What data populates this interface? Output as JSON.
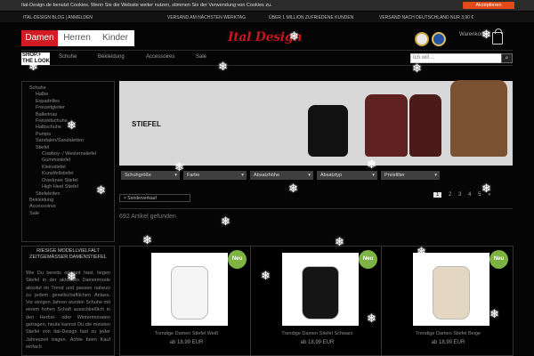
{
  "cookie": {
    "text": "Ital-Design.de benutzt Cookies. Wenn Sie die Website weiter nutzen, stimmen Sie der Verwendung von Cookies zu.",
    "button": "Akzeptieren"
  },
  "topbar": {
    "left": "ITAL-DESIGN BLOG | ANMELDEN",
    "center1": "VERSAND AM NÄCHSTEN WERKTAG",
    "center2": "ÜBER 1 MILLION ZUFRIEDENE KUNDEN",
    "right": "VERSAND NACH DEUTSCHLAND NUR 3,90 €"
  },
  "header": {
    "genders": [
      "Damen",
      "Herren",
      "Kinder"
    ],
    "logo": "Ital Design",
    "cart_label": "Warenkorb"
  },
  "nav": {
    "shop_logo": "SHOP.+\nTHE LOOK",
    "items": [
      "Schuhe",
      "Bekleidung",
      "Accessoires",
      "Sale"
    ],
    "search_placeholder": "Ich will ..."
  },
  "sidebar": {
    "items": [
      {
        "label": "Schuhe",
        "level": 0
      },
      {
        "label": "Halbe",
        "level": 1
      },
      {
        "label": "Espadrilles",
        "level": 1
      },
      {
        "label": "Freizeitgleiter",
        "level": 1
      },
      {
        "label": "Ballerinas",
        "level": 1
      },
      {
        "label": "Freizeitschuhe",
        "level": 1
      },
      {
        "label": "Halbschuhe",
        "level": 1
      },
      {
        "label": "Pumps",
        "level": 1
      },
      {
        "label": "Sandalen/Sandaletten",
        "level": 1
      },
      {
        "label": "Stiefel",
        "level": 1
      },
      {
        "label": "Cowboy- / Westernstiefel",
        "level": 2
      },
      {
        "label": "Gummistiefel",
        "level": 2
      },
      {
        "label": "Kleinstiefel",
        "level": 2
      },
      {
        "label": "Kunstfellstiefel",
        "level": 2
      },
      {
        "label": "Overknee Stiefel",
        "level": 2
      },
      {
        "label": "High Heel Stiefel",
        "level": 2
      },
      {
        "label": "Stiefeletten",
        "level": 1
      },
      {
        "label": "Bekleidung",
        "level": 0
      },
      {
        "label": "Accessoires",
        "level": 0
      },
      {
        "label": "Sale",
        "level": 0
      }
    ]
  },
  "hero": {
    "title": "STIEFEL"
  },
  "filters": [
    "Schuhgröße",
    "Farbe",
    "Absatzhöhe",
    "Absatztyp",
    "Preisfilter"
  ],
  "tag": "× Sonderverkauf",
  "pagination": [
    "1",
    "2",
    "3",
    "4",
    "5",
    "»"
  ],
  "count": "692 Artikel gefunden",
  "promo": {
    "title": "RIESIGE MODELLVIELFALT\nZEITGEMÄSSER DAMENSTIEFEL",
    "text": "Wie Du bereits erkannt hast, liegen Stiefel in der aktuellen Damenmode absolut im Trend und passen nahezu zu jedem gesellschaftlichen Anlass. Vor einigen Jahren wurden Schuhe mit einem hohen Schaft ausschließlich in den Herbst- oder Wintermonaten getragen, heute kannst Du die meisten Stiefel von Ital-Design fast zu jeder Jahreszeit tragen. Achte beim Kauf einfach"
  },
  "products": [
    {
      "name": "Trendige Damen Stiefel Weiß",
      "price": "ab 18,99 EUR",
      "badge": "Neu",
      "color": "#f5f5f5"
    },
    {
      "name": "Trendige Damen Stiefel Schwarz",
      "price": "ab 18,99 EUR",
      "badge": "Neu",
      "color": "#151515"
    },
    {
      "name": "Trendige Damen Stiefel Beige",
      "price": "ab 18,99 EUR",
      "badge": "Neu",
      "color": "#e3d7c2"
    }
  ],
  "colors": {
    "brand_red": "#d21b23",
    "accent_orange": "#e34a19",
    "badge_green": "#7cb342"
  },
  "icons": {
    "search": "search-icon",
    "cart": "cart-icon",
    "snowflake": "snowflake-icon"
  }
}
